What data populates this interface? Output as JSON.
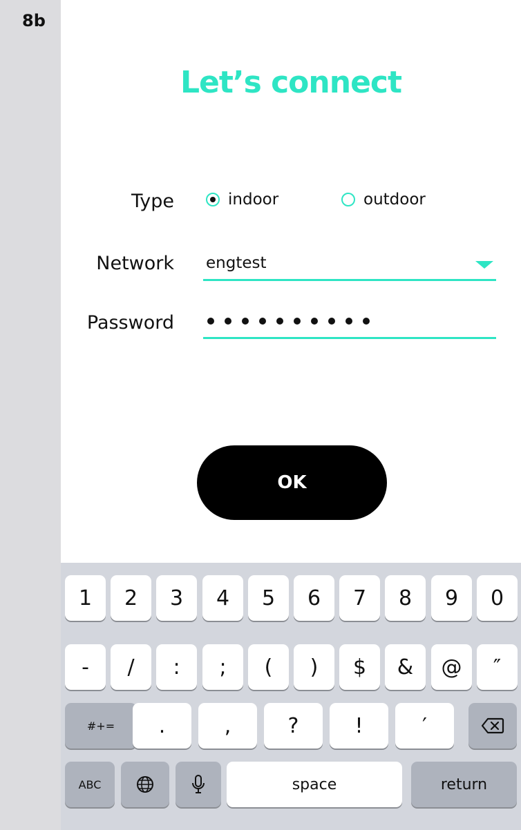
{
  "step_label": "8b",
  "title": "Let’s connect",
  "form": {
    "type_label": "Type",
    "type_options": [
      {
        "label": "indoor",
        "selected": true
      },
      {
        "label": "outdoor",
        "selected": false
      }
    ],
    "network_label": "Network",
    "network_value": "engtest",
    "password_label": "Password",
    "password_masked": "●●●●●●●●●●"
  },
  "ok_label": "OK",
  "keyboard": {
    "row1": [
      "1",
      "2",
      "3",
      "4",
      "5",
      "6",
      "7",
      "8",
      "9",
      "0"
    ],
    "row2": [
      "-",
      "/",
      ":",
      ";",
      "(",
      ")",
      "$",
      "&",
      "@",
      "″"
    ],
    "row3_toggle": "#+=",
    "row3": [
      ".",
      ",",
      "?",
      "!",
      "′"
    ],
    "row4_abc": "ABC",
    "row4_space": "space",
    "row4_return": "return",
    "icons": {
      "delete": "backspace-icon",
      "globe": "globe-icon",
      "mic": "microphone-icon"
    }
  },
  "colors": {
    "accent": "#2ee5c4",
    "button": "#000000",
    "keyboard_bg": "#d3d6dd"
  }
}
